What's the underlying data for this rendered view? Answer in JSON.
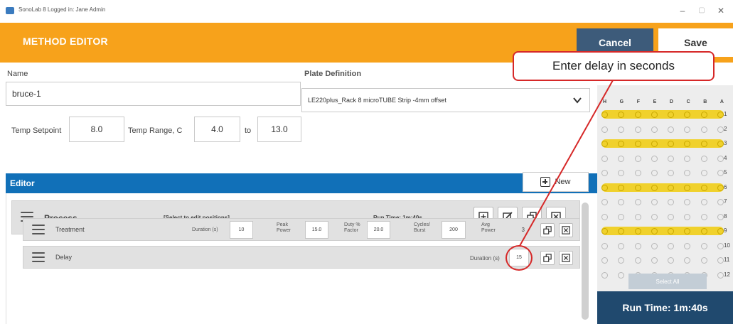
{
  "window": {
    "title": "SonoLab 8 Logged in: Jane Admin",
    "minimize": "–",
    "maximize": "▢",
    "close": "✕"
  },
  "header": {
    "title": "METHOD EDITOR",
    "cancel_label": "Cancel",
    "save_label": "Save"
  },
  "form": {
    "name_label": "Name",
    "name_value": "bruce-1",
    "plate_label": "Plate Definition",
    "plate_value": "LE220plus_Rack 8 microTUBE Strip -4mm offset",
    "temp_setpoint_label": "Temp Setpoint",
    "temp_setpoint_value": "8.0",
    "temp_range_label": "Temp Range, C",
    "temp_range_low": "4.0",
    "to_label": "to",
    "temp_range_high": "13.0"
  },
  "editor": {
    "label": "Editor",
    "new_label": "New",
    "process": {
      "label": "Process",
      "hint": "[Select to edit positions]",
      "run_time": "Run Time: 1m:40s"
    },
    "treatment": {
      "label": "Treatment",
      "duration_label": "Duration (s)",
      "duration_value": "10",
      "peak_power_label_1": "Peak",
      "peak_power_label_2": "Power",
      "peak_power_value": "15.0",
      "duty_label_1": "Duty %",
      "duty_label_2": "Factor",
      "duty_value": "20.0",
      "cycles_label_1": "Cycles/",
      "cycles_label_2": "Burst",
      "cycles_value": "200",
      "avg_power_label_1": "Avg",
      "avg_power_label_2": "Power",
      "avg_power_value": "3"
    },
    "delay": {
      "label": "Delay",
      "duration_label": "Duration (s)",
      "duration_value": "15"
    }
  },
  "plate_grid": {
    "columns": [
      "H",
      "G",
      "F",
      "E",
      "D",
      "C",
      "B",
      "A"
    ],
    "rows": [
      {
        "num": "1",
        "highlighted": true
      },
      {
        "num": "2",
        "highlighted": false
      },
      {
        "num": "3",
        "highlighted": true
      },
      {
        "num": "4",
        "highlighted": false
      },
      {
        "num": "5",
        "highlighted": false
      },
      {
        "num": "6",
        "highlighted": true
      },
      {
        "num": "7",
        "highlighted": false
      },
      {
        "num": "8",
        "highlighted": false
      },
      {
        "num": "9",
        "highlighted": true
      },
      {
        "num": "10",
        "highlighted": false
      },
      {
        "num": "11",
        "highlighted": false
      },
      {
        "num": "12",
        "highlighted": false
      }
    ],
    "select_all_label": "Select All",
    "run_time": "Run Time: 1m:40s"
  },
  "callout": {
    "text": "Enter delay in seconds"
  },
  "colors": {
    "header_orange": "#f7a21b",
    "editor_blue": "#1170b8",
    "cancel_navy": "#3d5b7a",
    "runtime_navy": "#20496e",
    "highlight_yellow": "#f0d12c",
    "callout_red": "#d62828"
  }
}
